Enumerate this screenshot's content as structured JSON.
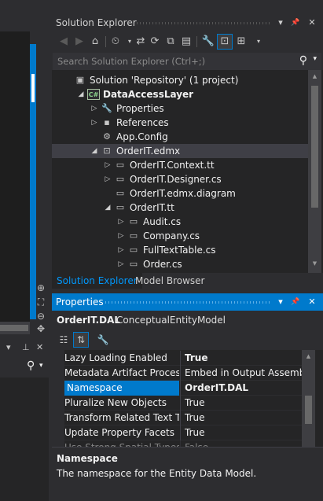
{
  "solution_explorer": {
    "title": "Solution Explorer",
    "pin_glyph": "▾",
    "autohide_glyph": "📌",
    "close_glyph": "✕",
    "search_placeholder": "Search Solution Explorer (Ctrl+;)",
    "tree": [
      {
        "label": "Solution 'Repository' (1 project)",
        "icon": "solution-icon",
        "arrow": "",
        "bold": false
      },
      {
        "label": "DataAccessLayer",
        "icon": "csharp-project-icon",
        "arrow": "◢",
        "bold": true
      },
      {
        "label": "Properties",
        "icon": "wrench-icon",
        "arrow": "▷",
        "bold": false
      },
      {
        "label": "References",
        "icon": "references-icon",
        "arrow": "▷",
        "bold": false
      },
      {
        "label": "App.Config",
        "icon": "config-file-icon",
        "arrow": "",
        "bold": false
      },
      {
        "label": "OrderIT.edmx",
        "icon": "edmx-icon",
        "arrow": "◢",
        "bold": false,
        "selected": true
      },
      {
        "label": "OrderIT.Context.tt",
        "icon": "tt-file-icon",
        "arrow": "▷",
        "bold": false
      },
      {
        "label": "OrderIT.Designer.cs",
        "icon": "cs-file-icon",
        "arrow": "▷",
        "bold": false
      },
      {
        "label": "OrderIT.edmx.diagram",
        "icon": "diagram-file-icon",
        "arrow": "",
        "bold": false
      },
      {
        "label": "OrderIT.tt",
        "icon": "tt-file-icon",
        "arrow": "◢",
        "bold": false
      },
      {
        "label": "Audit.cs",
        "icon": "cs-file-icon",
        "arrow": "▷",
        "bold": false
      },
      {
        "label": "Company.cs",
        "icon": "cs-file-icon",
        "arrow": "▷",
        "bold": false
      },
      {
        "label": "FullTextTable.cs",
        "icon": "cs-file-icon",
        "arrow": "▷",
        "bold": false
      },
      {
        "label": "Order.cs",
        "icon": "cs-file-icon",
        "arrow": "▷",
        "bold": false
      }
    ],
    "tabs": [
      "Solution Explorer",
      "Model Browser"
    ],
    "project_badge": "C#"
  },
  "properties": {
    "title": "Properties",
    "object_name": "OrderIT.DAL",
    "object_type": "ConceptualEntityModel",
    "rows": [
      {
        "name": "Lazy Loading Enabled",
        "value": "True",
        "bold": true
      },
      {
        "name": "Metadata Artifact Processin",
        "value": "Embed in Output Assembly",
        "bold": false
      },
      {
        "name": "Namespace",
        "value": "OrderIT.DAL",
        "bold": true,
        "selected": true
      },
      {
        "name": "Pluralize New Objects",
        "value": "True",
        "bold": false
      },
      {
        "name": "Transform Related Text Ter",
        "value": "True",
        "bold": false
      },
      {
        "name": "Update Property Facets",
        "value": "True",
        "bold": false
      },
      {
        "name": "Use Strong Spatial Types",
        "value": "False",
        "bold": false,
        "faded": true
      }
    ],
    "description_title": "Namespace",
    "description_text": "The namespace for the Entity Data Model."
  },
  "colors": {
    "accent": "#007acc",
    "background": "#2d2d30",
    "panel": "#252526",
    "selection": "#3f3f46"
  }
}
